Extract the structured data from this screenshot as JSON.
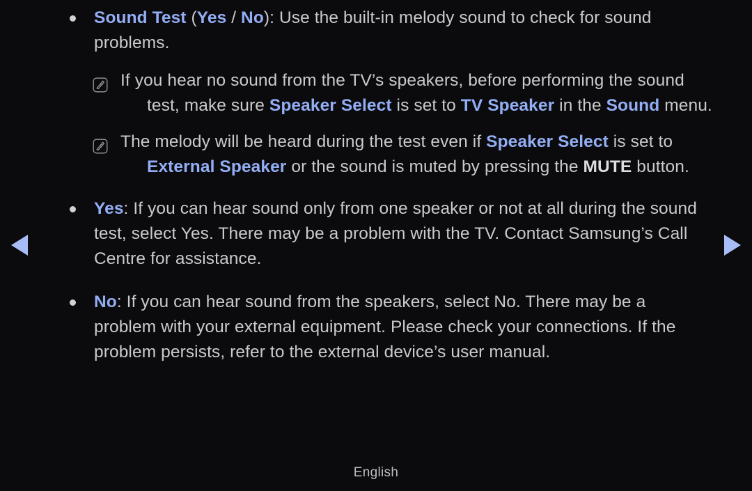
{
  "page": {
    "background_color": "#0b0b0d",
    "accent_color": "#93aef5",
    "text_color": "#c9cacc"
  },
  "nav": {
    "prev_label": "◀",
    "next_label": "▶"
  },
  "footer": {
    "language": "English"
  },
  "body": {
    "sound_test": {
      "term": "Sound Test",
      "paren_open": " (",
      "option_yes": "Yes",
      "slash": " / ",
      "option_no": "No",
      "paren_close": "): ",
      "line1_rest": "Use the built-in melody sound to check for sound",
      "line2": "problems."
    },
    "note1": {
      "line1": "If you hear no sound from the TV’s speakers, before performing the sound",
      "line2_a": "test, make sure ",
      "line2_b": "Speaker Select",
      "line2_c": " is set to ",
      "line2_d": "TV Speaker",
      "line2_e": " in the ",
      "line2_f": "Sound",
      "line2_g": " menu."
    },
    "note2": {
      "line1_a": "The melody will be heard during the test even if ",
      "line1_b": "Speaker Select",
      "line1_c": " is set to",
      "line2_a": "External Speaker",
      "line2_b": " or the sound is muted by pressing the ",
      "line2_c": "MUTE",
      "line2_d": " button."
    },
    "yes_item": {
      "term": "Yes",
      "line1_rest": ": If you can hear sound only from one speaker or not at all during the sound",
      "line2": "test, select Yes. There may be a problem with the TV. Contact Samsung’s Call",
      "line3": "Centre for assistance."
    },
    "no_item": {
      "term": "No",
      "line1_rest": ": If you can hear sound from the speakers, select No. There may be a",
      "line2": "problem with your external equipment. Please check your connections. If the",
      "line3": "problem persists, refer to the external device’s user manual."
    }
  }
}
